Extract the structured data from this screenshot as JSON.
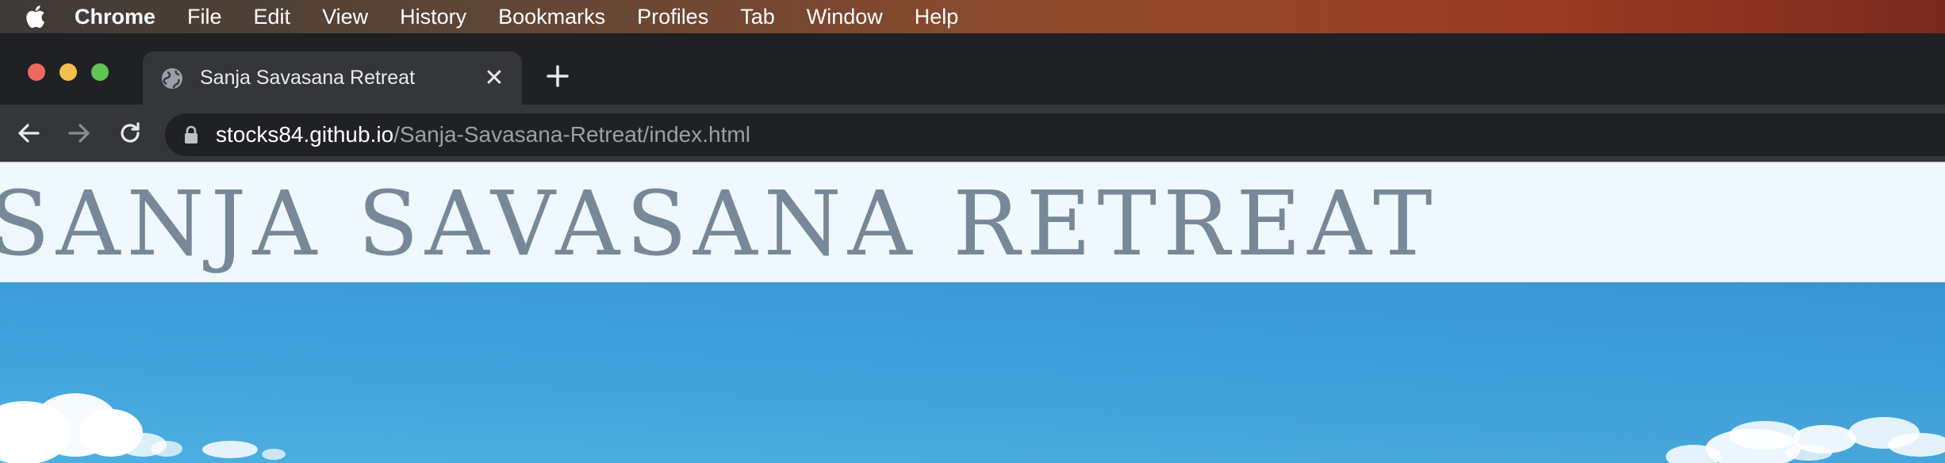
{
  "menubar": {
    "app_name": "Chrome",
    "items": [
      "File",
      "Edit",
      "View",
      "History",
      "Bookmarks",
      "Profiles",
      "Tab",
      "Window",
      "Help"
    ]
  },
  "tab": {
    "title": "Sanja Savasana Retreat",
    "icon": "globe-icon",
    "close_label": "✕"
  },
  "omnibox": {
    "url_host": "stocks84.github.io",
    "url_path": "/Sanja-Savasana-Retreat/index.html"
  },
  "site": {
    "title": "SANJA SAVASANA RETREAT",
    "title_color": "#778899",
    "header_bg": "#f0f8ff"
  },
  "colors": {
    "tab_active": "#35363a",
    "tabstrip": "#202124",
    "sky": "#3fa4dc"
  }
}
